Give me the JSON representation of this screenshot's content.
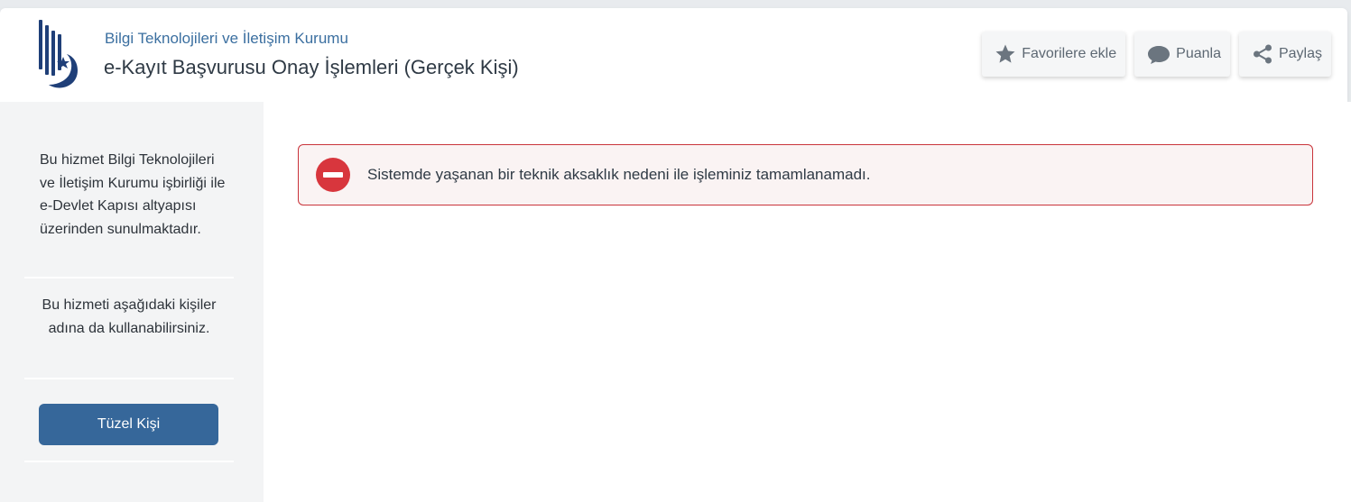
{
  "header": {
    "org_name": "Bilgi Teknolojileri ve İletişim Kurumu",
    "service_title": "e-Kayıt Başvurusu Onay İşlemleri (Gerçek Kişi)",
    "actions": {
      "favorite_label": "Favorilere ekle",
      "rate_label": "Puanla",
      "share_label": "Paylaş"
    },
    "icons": {
      "favorite": "star-icon",
      "rate": "speech-bubble-icon",
      "share": "share-icon"
    }
  },
  "sidebar": {
    "provider_text": "Bu hizmet Bilgi Teknolojileri ve İletişim Kurumu işbirliği ile e-Devlet Kapısı altyapısı üzerinden sunulmaktadır.",
    "on_behalf_text": "Bu hizmeti aşağıdaki kişiler adına da kullanabilirsiniz.",
    "tuzel_button_label": "Tüzel Kişi"
  },
  "alert": {
    "message": "Sistemde yaşanan bir teknik aksaklık nedeni ile işleminiz tamamlanamadı.",
    "icon": "error-minus-icon"
  },
  "colors": {
    "brand_blue": "#36679a",
    "org_name": "#3b6fa0",
    "error_red": "#c9343b",
    "alert_bg": "#faf3f3",
    "sidebar_bg": "#f3f4f5"
  }
}
